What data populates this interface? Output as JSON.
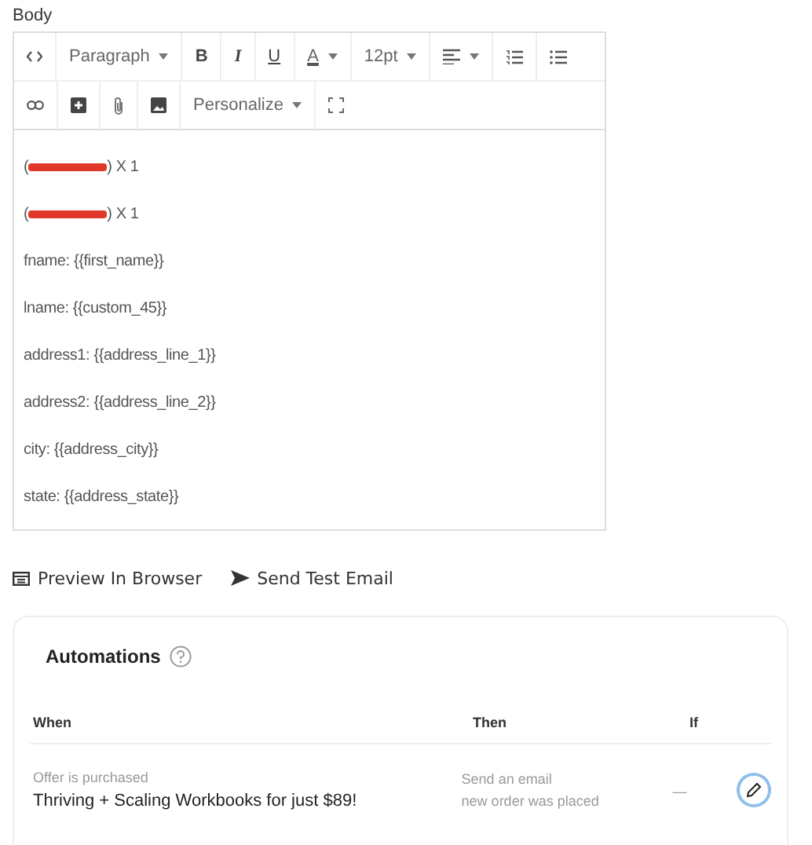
{
  "body_label": "Body",
  "toolbar": {
    "format": "Paragraph",
    "bold": "B",
    "italic": "I",
    "underline": "U",
    "text_color": "A",
    "font_size": "12pt",
    "personalize": "Personalize"
  },
  "content_lines": [
    {
      "kind": "redacted",
      "before": "(",
      "after": ") X 1"
    },
    {
      "kind": "redacted",
      "before": "(",
      "after": ") X 1"
    },
    {
      "kind": "text",
      "text": "fname: {{first_name}}"
    },
    {
      "kind": "text",
      "text": "lname: {{custom_45}}"
    },
    {
      "kind": "text",
      "text": "address1: {{address_line_1}}"
    },
    {
      "kind": "text",
      "text": "address2: {{address_line_2}}"
    },
    {
      "kind": "text",
      "text": "city: {{address_city}}"
    },
    {
      "kind": "text",
      "text": "state: {{address_state}}"
    }
  ],
  "actions": {
    "preview": "Preview In Browser",
    "send_test": "Send Test Email"
  },
  "automations": {
    "title": "Automations",
    "columns": [
      "When",
      "Then",
      "If"
    ],
    "rows": [
      {
        "when_label": "Offer is purchased",
        "when_value": "Thriving + Scaling Workbooks for just $89!",
        "then_label": "Send an email",
        "then_value": "new order was placed",
        "if": "—"
      }
    ]
  }
}
